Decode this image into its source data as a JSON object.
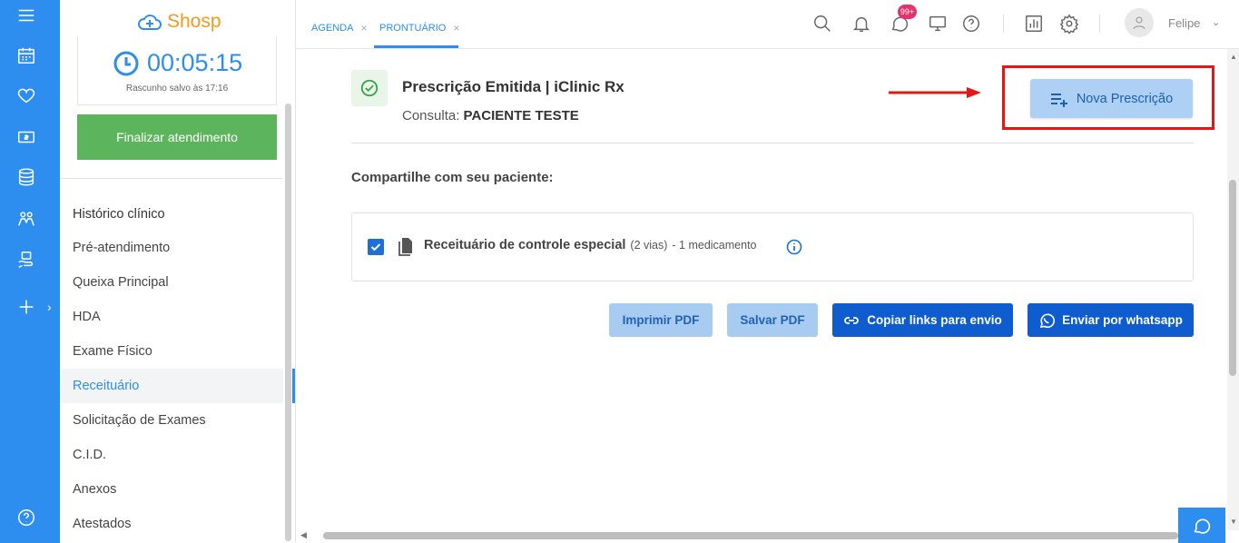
{
  "app": {
    "logo_text": "Shosp",
    "brand_color": "#2e8ef0",
    "logo_accent": "#f39a1b"
  },
  "rail": {
    "icons": [
      "menu-icon",
      "calendar-icon",
      "heart-icon",
      "money-icon",
      "database-icon",
      "users-icon",
      "medical-desk-icon",
      "plus-icon"
    ],
    "bottom_icon": "help-icon"
  },
  "sidebar": {
    "timer": "00:05:15",
    "draft_saved": "Rascunho salvo às 17:16",
    "finalize_label": "Finalizar atendimento",
    "finalize_color": "#5cb45c",
    "heading": "Histórico clínico",
    "items": [
      {
        "label": "Pré-atendimento"
      },
      {
        "label": "Queixa Principal"
      },
      {
        "label": "HDA"
      },
      {
        "label": "Exame Físico"
      },
      {
        "label": "Receituário",
        "active": true
      },
      {
        "label": "Solicitação de Exames"
      },
      {
        "label": "C.I.D."
      },
      {
        "label": "Anexos"
      },
      {
        "label": "Atestados"
      }
    ]
  },
  "header": {
    "tabs": [
      {
        "label": "AGENDA",
        "close": "×"
      },
      {
        "label": "PRONTUÁRIO",
        "close": "×",
        "active": true
      }
    ],
    "notifications_badge": "99+",
    "user_name": "Felipe"
  },
  "main": {
    "status_title": "Prescrição Emitida | iClinic Rx",
    "consulta_label": "Consulta:",
    "patient_name": "PACIENTE TESTE",
    "new_prescription_label": "Nova Prescrição",
    "highlight_color": "#e81515",
    "share_heading": "Compartilhe com seu paciente:",
    "document": {
      "checked": true,
      "title": "Receituário de controle especial",
      "copies": "(2 vias)",
      "count": "- 1 medicamento"
    },
    "actions": [
      {
        "label": "Imprimir PDF"
      },
      {
        "label": "Salvar PDF"
      },
      {
        "label": "Copiar links para envio",
        "icon": "link-icon"
      },
      {
        "label": "Enviar por whatsapp",
        "icon": "whatsapp-icon"
      }
    ]
  }
}
